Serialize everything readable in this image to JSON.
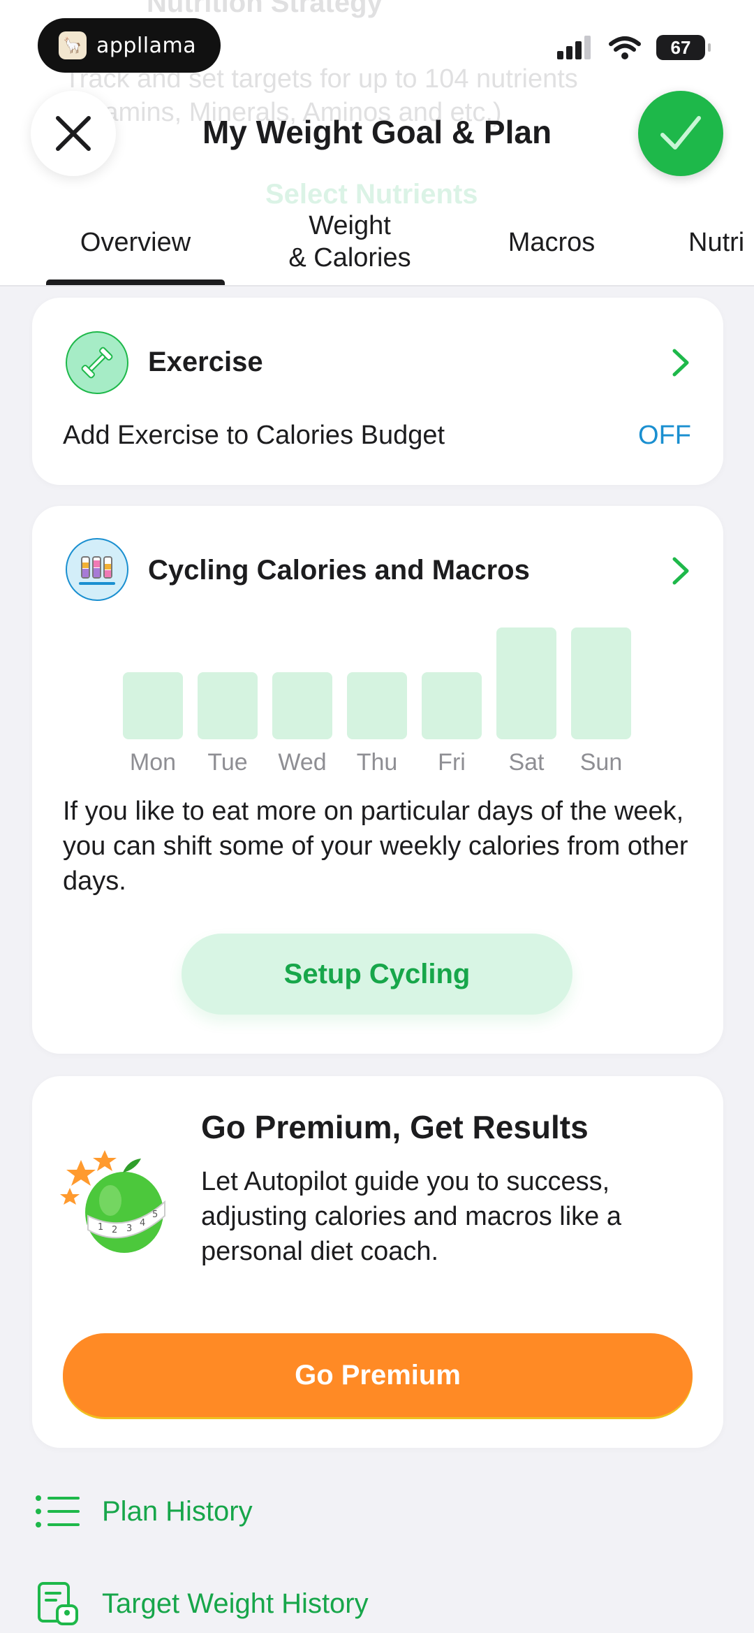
{
  "background_hint": {
    "title": "Nutrition Strategy",
    "line1": "Track and set targets for up to 104 nutrients",
    "line2": "(Vitamins, Minerals, Aminos and etc.)",
    "link": "Select Nutrients"
  },
  "status_bar": {
    "app_badge": "appllama",
    "battery": "67"
  },
  "header": {
    "title": "My Weight Goal & Plan"
  },
  "tabs": [
    {
      "label": "Overview",
      "active": true
    },
    {
      "label_line1": "Weight",
      "label_line2": "& Calories",
      "active": false
    },
    {
      "label": "Macros",
      "active": false
    },
    {
      "label": "Nutri",
      "active": false
    }
  ],
  "exercise": {
    "title": "Exercise",
    "setting_label": "Add Exercise to Calories Budget",
    "setting_value": "OFF"
  },
  "cycling": {
    "title": "Cycling Calories and Macros",
    "days": [
      {
        "label": "Mon",
        "level": 0.6
      },
      {
        "label": "Tue",
        "level": 0.6
      },
      {
        "label": "Wed",
        "level": 0.6
      },
      {
        "label": "Thu",
        "level": 0.6
      },
      {
        "label": "Fri",
        "level": 0.6
      },
      {
        "label": "Sat",
        "level": 1.0
      },
      {
        "label": "Sun",
        "level": 1.0
      }
    ],
    "description": "If you like to eat more on particular days of the week, you can shift some of your weekly calories from other days.",
    "button": "Setup Cycling"
  },
  "premium": {
    "title": "Go Premium, Get Results",
    "description": "Let Autopilot guide you to success, adjusting calories and macros like a personal diet coach.",
    "button": "Go Premium"
  },
  "links": {
    "plan_history": "Plan History",
    "target_weight_history": "Target Weight History"
  },
  "colors": {
    "accent_green": "#1eb84a",
    "link_blue": "#1a8fd0",
    "premium_orange": "#ff8a25"
  }
}
